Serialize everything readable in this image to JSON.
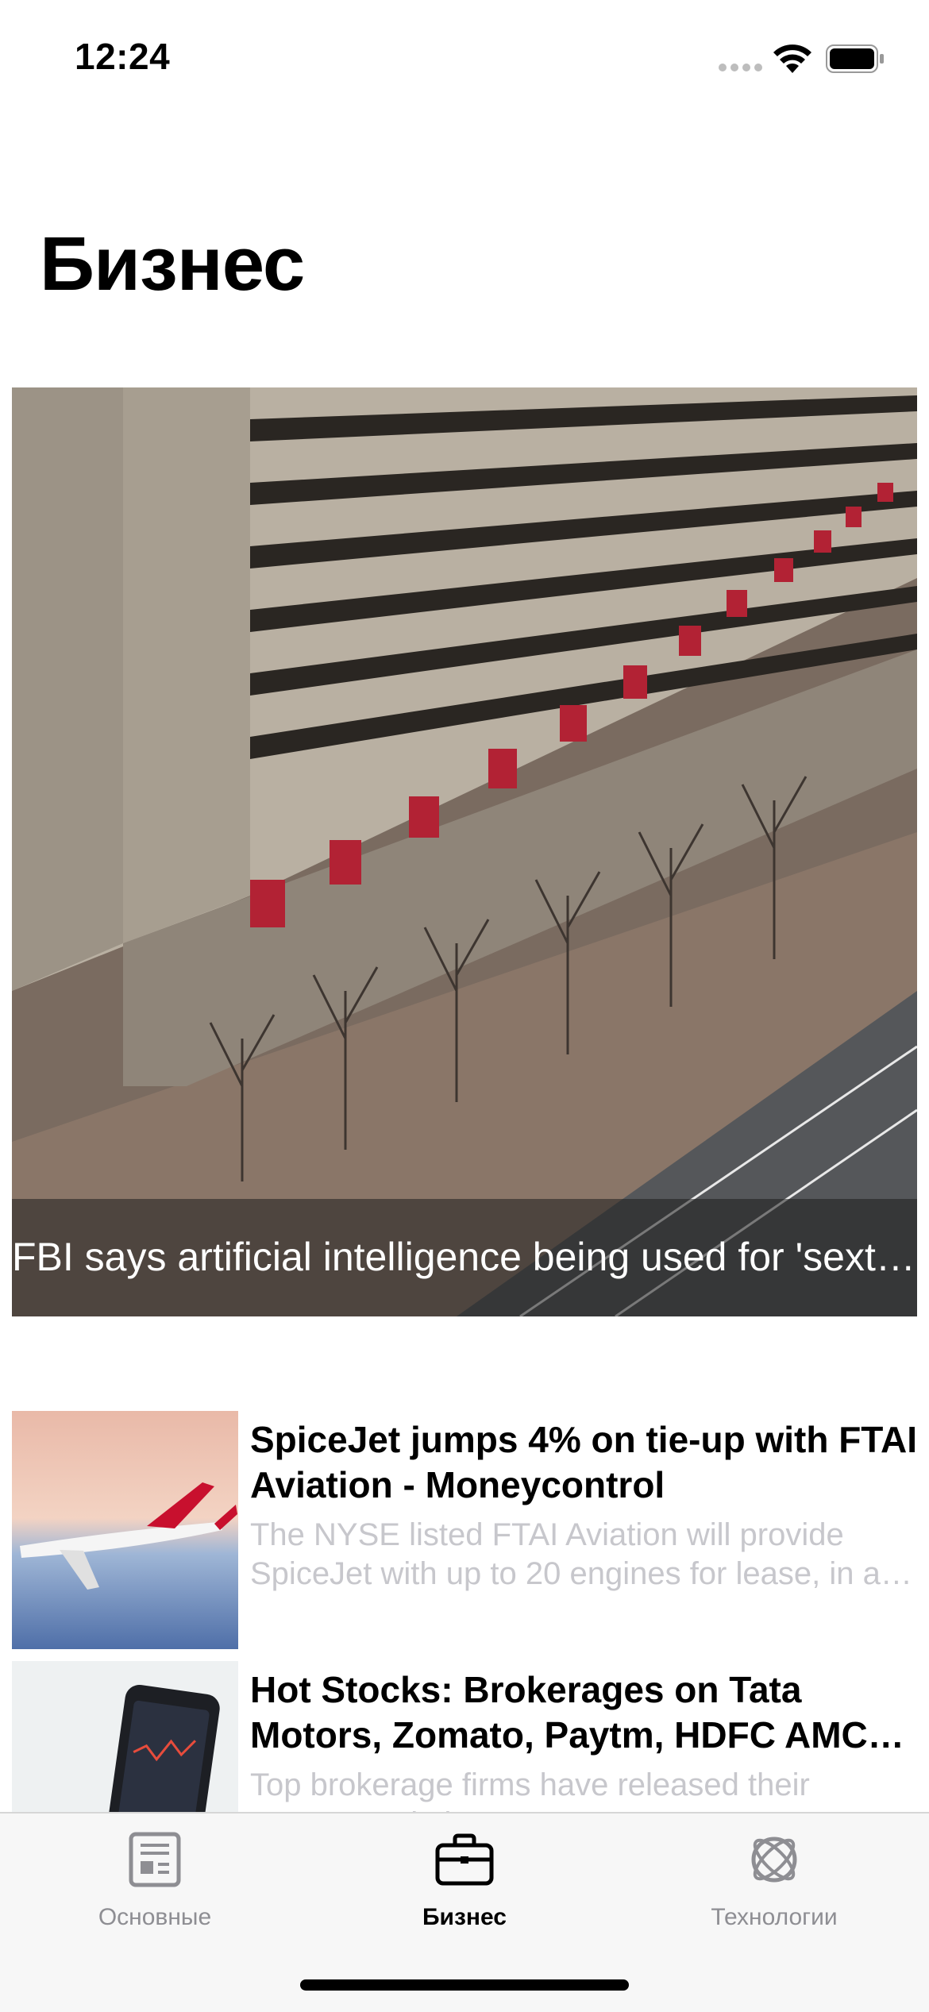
{
  "status_bar": {
    "time": "12:24"
  },
  "page": {
    "title": "Бизнес"
  },
  "hero": {
    "caption": "FBI says artificial intelligence being used for 'sextortion' and harassment"
  },
  "news_list": [
    {
      "title": "SpiceJet jumps 4% on tie-up with FTAI Aviation - Moneycontrol",
      "description": "The NYSE listed FTAI Aviation will provide SpiceJet with up to 20 engines for lease, in a bid to improve its fleet availability"
    },
    {
      "title": "Hot Stocks: Brokerages on Tata Motors, Zomato, Paytm, HDFC AMC and others",
      "description": "Top brokerage firms have released their recommendations"
    }
  ],
  "tab_bar": {
    "tabs": [
      {
        "label": "Основные",
        "icon": "newspaper-icon",
        "active": false
      },
      {
        "label": "Бизнес",
        "icon": "briefcase-icon",
        "active": true
      },
      {
        "label": "Технологии",
        "icon": "atom-icon",
        "active": false
      }
    ]
  },
  "colors": {
    "tab_inactive": "#8e8e93",
    "tab_active": "#000000",
    "description_text": "#c7c7cc"
  }
}
